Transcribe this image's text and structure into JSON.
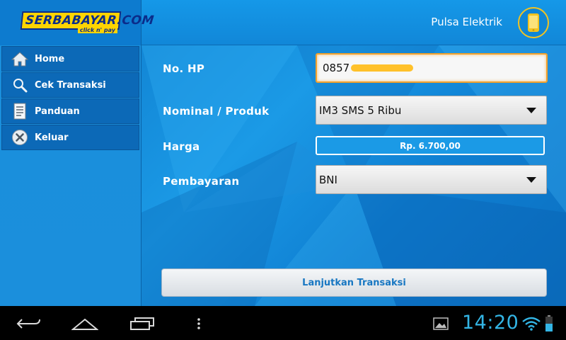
{
  "header": {
    "logo_text": "SERBABAYAR.COM",
    "logo_tagline": "click n' pay",
    "page_title": "Pulsa Elektrik",
    "icon": "phone-icon"
  },
  "sidebar": {
    "items": [
      {
        "label": "Home",
        "icon": "home-icon"
      },
      {
        "label": "Cek Transaksi",
        "icon": "search-icon"
      },
      {
        "label": "Panduan",
        "icon": "document-icon"
      },
      {
        "label": "Keluar",
        "icon": "close-icon"
      }
    ]
  },
  "form": {
    "phone_label": "No. HP",
    "phone_value": "0857",
    "nominal_label": "Nominal / Produk",
    "nominal_value": "IM3 SMS 5 Ribu",
    "price_label": "Harga",
    "price_value": "Rp. 6.700,00",
    "payment_label": "Pembayaran",
    "payment_value": "BNI",
    "submit_label": "Lanjutkan Transaksi"
  },
  "statusbar": {
    "time": "14:20",
    "icons": [
      "back-icon",
      "home-icon",
      "recent-apps-icon",
      "menu-icon",
      "gallery-icon",
      "wifi-icon",
      "battery-icon"
    ]
  },
  "colors": {
    "accent": "#1b9ae6",
    "clock": "#33b5e5",
    "logo_yellow": "#ffd400",
    "focus_border": "#f2a12c"
  }
}
